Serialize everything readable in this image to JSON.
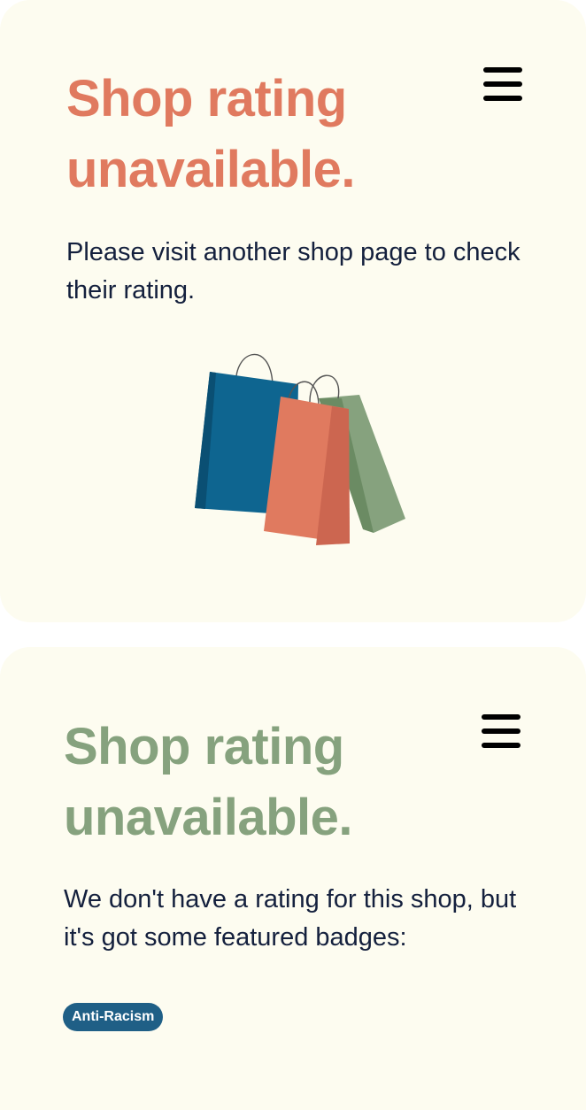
{
  "cards": [
    {
      "title": "Shop rating unavailable.",
      "description": "Please visit another shop page to check their rating.",
      "title_color": "#e07a5f",
      "menu_icon": "hamburger-menu-icon",
      "illustration": "shopping-bags-illustration"
    },
    {
      "title": "Shop rating unavailable.",
      "description": "We don't have a rating for this shop, but it's got some featured badges:",
      "title_color": "#86a27e",
      "menu_icon": "hamburger-menu-icon",
      "badges": [
        "Anti-Racism"
      ]
    }
  ],
  "colors": {
    "card_background": "#fdfcf0",
    "text": "#14203d",
    "badge_background": "#1f5f86",
    "bag_blue": "#0e6590",
    "bag_orange": "#e07a5f",
    "bag_green": "#86a27e"
  }
}
